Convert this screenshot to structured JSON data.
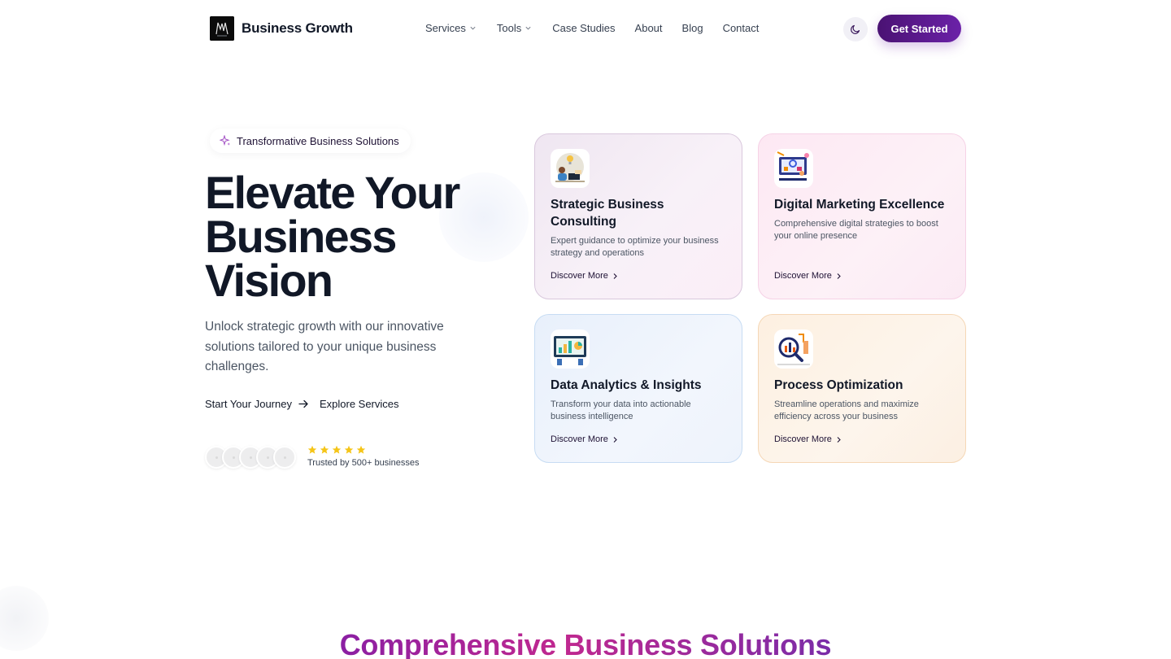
{
  "brand": {
    "name": "Business Growth"
  },
  "nav": {
    "items": [
      {
        "label": "Services",
        "dropdown": true
      },
      {
        "label": "Tools",
        "dropdown": true
      },
      {
        "label": "Case Studies",
        "dropdown": false
      },
      {
        "label": "About",
        "dropdown": false
      },
      {
        "label": "Blog",
        "dropdown": false
      },
      {
        "label": "Contact",
        "dropdown": false
      }
    ],
    "theme_toggle_icon": "moon-icon",
    "cta_label": "Get Started"
  },
  "hero": {
    "badge": "Transformative Business Solutions",
    "title_lines": [
      "Elevate Your",
      "Business",
      "Vision"
    ],
    "subtitle": "Unlock strategic growth with our innovative solutions tailored to your unique business challenges.",
    "primary_action": "Start Your Journey",
    "secondary_action": "Explore Services",
    "rating_stars": 5,
    "trusted_text": "Trusted by 500+ businesses"
  },
  "services": [
    {
      "title": "Strategic Business Consulting",
      "description": "Expert guidance to optimize your business strategy and operations",
      "link": "Discover More",
      "icon": "consulting-illustration-icon"
    },
    {
      "title": "Digital Marketing Excellence",
      "description": "Comprehensive digital strategies to boost your online presence",
      "link": "Discover More",
      "icon": "marketing-illustration-icon"
    },
    {
      "title": "Data Analytics & Insights",
      "description": "Transform your data into actionable business intelligence",
      "link": "Discover More",
      "icon": "analytics-illustration-icon"
    },
    {
      "title": "Process Optimization",
      "description": "Streamline operations and maximize efficiency across your business",
      "link": "Discover More",
      "icon": "optimization-illustration-icon"
    }
  ],
  "section": {
    "title": "Comprehensive Business Solutions"
  },
  "colors": {
    "accent": "#5b1a8c",
    "star": "#f5c518",
    "heading": "#111827"
  }
}
